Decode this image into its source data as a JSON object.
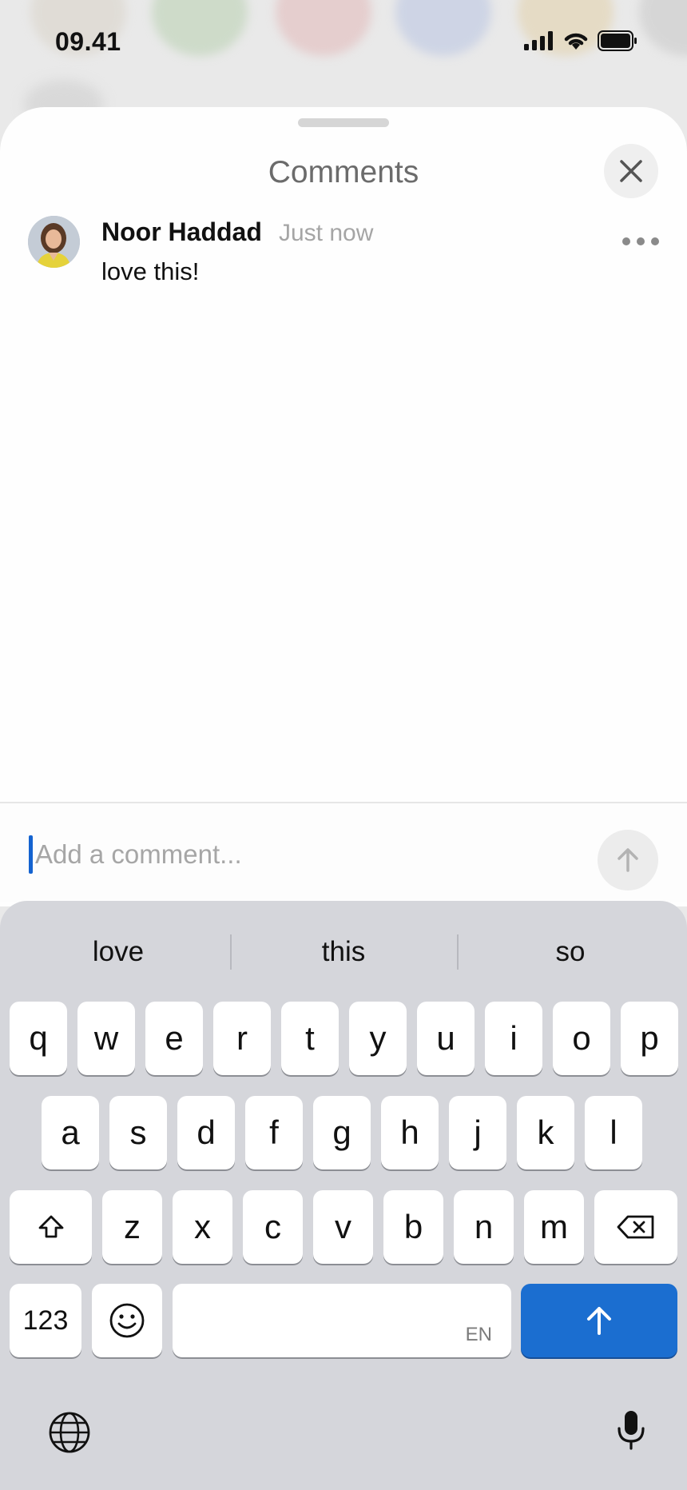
{
  "status_bar": {
    "time": "09.41"
  },
  "sheet": {
    "title": "Comments",
    "comments": [
      {
        "author": "Noor Haddad",
        "time": "Just now",
        "text": "love this!"
      }
    ]
  },
  "composer": {
    "placeholder": "Add a comment..."
  },
  "keyboard": {
    "suggestions": [
      "love",
      "this",
      "so"
    ],
    "rows": [
      [
        "q",
        "w",
        "e",
        "r",
        "t",
        "y",
        "u",
        "i",
        "o",
        "p"
      ],
      [
        "a",
        "s",
        "d",
        "f",
        "g",
        "h",
        "j",
        "k",
        "l"
      ],
      [
        "z",
        "x",
        "c",
        "v",
        "b",
        "n",
        "m"
      ]
    ],
    "numbers_label": "123",
    "space_hint": "EN"
  },
  "colors": {
    "accent": "#1b6ed0",
    "caret": "#1463d0",
    "keyboard_bg": "#d5d6db"
  }
}
